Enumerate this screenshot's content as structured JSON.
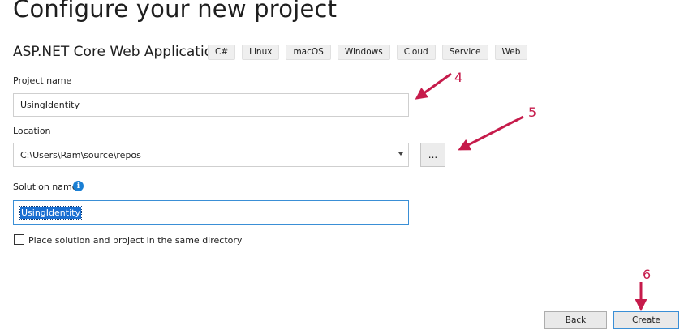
{
  "page": {
    "title": "Configure your new project"
  },
  "template": {
    "name": "ASP.NET Core Web Application",
    "tags": [
      "C#",
      "Linux",
      "macOS",
      "Windows",
      "Cloud",
      "Service",
      "Web"
    ]
  },
  "form": {
    "project_name": {
      "label": "Project name",
      "value": "UsingIdentity"
    },
    "location": {
      "label": "Location",
      "value": "C:\\Users\\Ram\\source\\repos",
      "browse_label": "..."
    },
    "solution_name": {
      "label": "Solution name",
      "value": "UsingIdentity",
      "info_icon": "i"
    },
    "same_directory": {
      "label": "Place solution and project in the same directory",
      "checked": false
    }
  },
  "footer": {
    "back_label": "Back",
    "create_label": "Create"
  },
  "annotations": {
    "color": "#c61b4b",
    "labels": [
      "4",
      "5",
      "6"
    ]
  }
}
